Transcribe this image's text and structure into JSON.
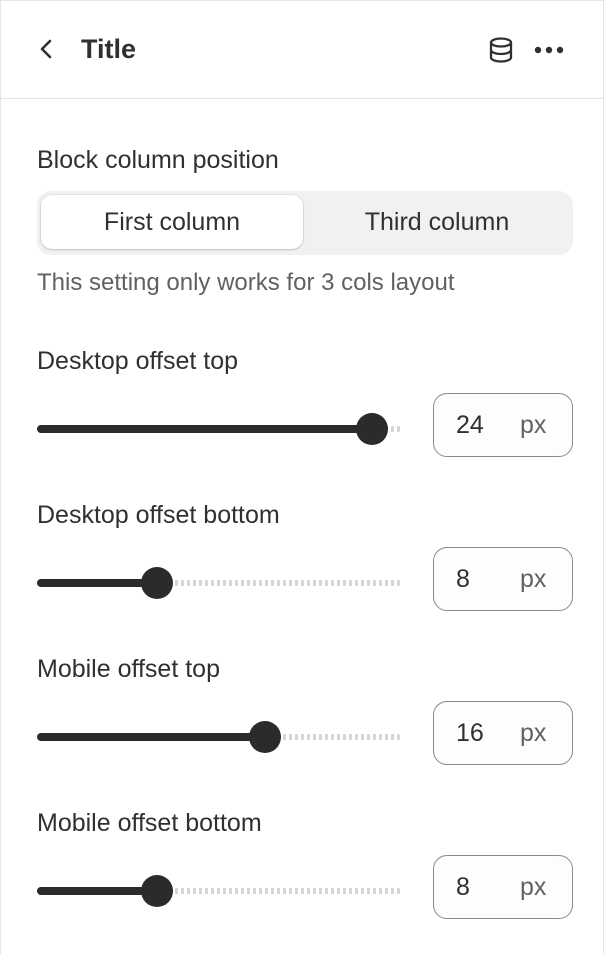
{
  "header": {
    "title": "Title",
    "back_icon": "chevron-left-icon",
    "data_icon": "database-icon",
    "more_icon": "more-horizontal-icon"
  },
  "block_column_position": {
    "label": "Block column position",
    "options": [
      "First column",
      "Third column"
    ],
    "selected": "First column",
    "help_text": "This setting only works for 3 cols layout"
  },
  "settings": [
    {
      "label": "Desktop offset top",
      "value": "24",
      "unit": "px",
      "level": 0.92
    },
    {
      "label": "Desktop offset bottom",
      "value": "8",
      "unit": "px",
      "level": 0.33
    },
    {
      "label": "Mobile offset top",
      "value": "16",
      "unit": "px",
      "level": 0.625
    },
    {
      "label": "Mobile offset bottom",
      "value": "8",
      "unit": "px",
      "level": 0.33
    }
  ],
  "colors": {
    "text": "#303030",
    "muted": "#616161",
    "slider_fill": "#2b2b2b",
    "segment_bg": "#f1f1f1"
  }
}
